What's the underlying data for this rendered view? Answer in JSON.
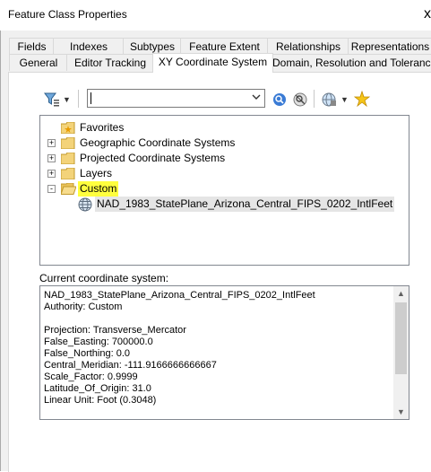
{
  "window": {
    "title": "Feature Class Properties",
    "close_glyph": "x"
  },
  "tabs": {
    "row_back": [
      "Fields",
      "Indexes",
      "Subtypes",
      "Feature Extent",
      "Relationships",
      "Representations"
    ],
    "row_front": [
      "General",
      "Editor Tracking",
      "XY Coordinate System",
      "Domain, Resolution and Tolerance"
    ],
    "active": "XY Coordinate System"
  },
  "toolbar": {
    "search_value": "",
    "icons": [
      "filter-icon",
      "dropdown-arrow-icon",
      "search-icon",
      "clear-search-icon",
      "globe-icon",
      "new-star-icon"
    ]
  },
  "tree": {
    "items": [
      {
        "label": "Favorites",
        "expander": "",
        "icon": "favorites-folder-icon"
      },
      {
        "label": "Geographic Coordinate Systems",
        "expander": "+",
        "icon": "folder-icon"
      },
      {
        "label": "Projected Coordinate Systems",
        "expander": "+",
        "icon": "folder-icon"
      },
      {
        "label": "Layers",
        "expander": "+",
        "icon": "folder-icon"
      },
      {
        "label": "Custom",
        "expander": "-",
        "icon": "open-folder-icon",
        "highlighted": true
      },
      {
        "label": "NAD_1983_StatePlane_Arizona_Central_FIPS_0202_IntlFeet",
        "expander": "",
        "icon": "globe-icon",
        "selected": true
      }
    ],
    "colors": {
      "highlight": "#ffff3e",
      "selected": "#e5e5e5"
    }
  },
  "current": {
    "label": "Current coordinate system:",
    "lines": [
      "NAD_1983_StatePlane_Arizona_Central_FIPS_0202_IntlFeet",
      "Authority: Custom",
      "",
      "Projection: Transverse_Mercator",
      "False_Easting: 700000.0",
      "False_Northing: 0.0",
      "Central_Meridian: -111.9166666666667",
      "Scale_Factor: 0.9999",
      "Latitude_Of_Origin: 31.0",
      "Linear Unit: Foot (0.3048)"
    ]
  }
}
